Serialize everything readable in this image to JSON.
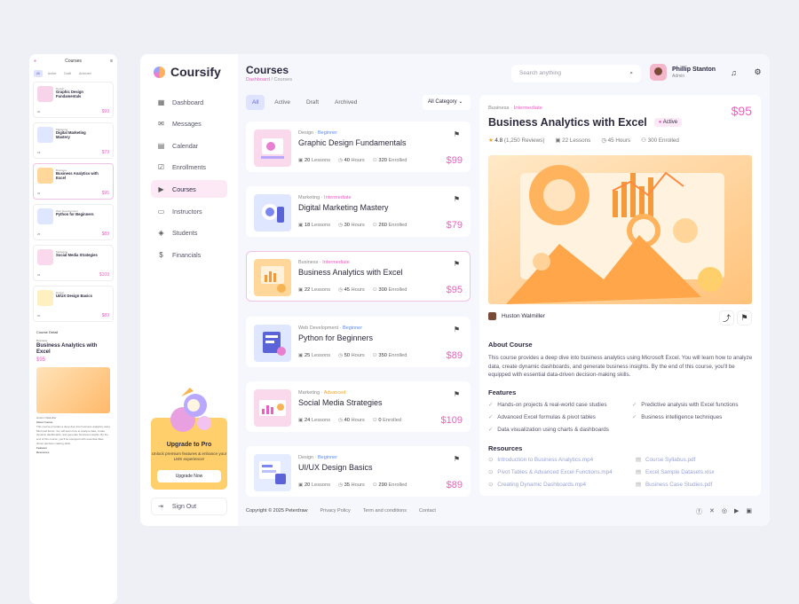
{
  "app": {
    "name": "Coursify"
  },
  "colors": {
    "accent": "#ec5ec2",
    "primary": "#5b64d6",
    "upgrade": "#ffcf6b"
  },
  "page": {
    "title": "Courses",
    "breadcrumb": [
      "Dashboard",
      "Courses"
    ]
  },
  "search": {
    "placeholder": "Search anything"
  },
  "user": {
    "name": "Phillip Stanton",
    "role": "Admin"
  },
  "nav": [
    {
      "label": "Dashboard",
      "icon": "grid-icon"
    },
    {
      "label": "Messages",
      "icon": "mail-icon"
    },
    {
      "label": "Calendar",
      "icon": "calendar-icon"
    },
    {
      "label": "Enrollments",
      "icon": "checkbox-icon"
    },
    {
      "label": "Courses",
      "icon": "play-icon"
    },
    {
      "label": "Instructors",
      "icon": "board-icon"
    },
    {
      "label": "Students",
      "icon": "graduation-icon"
    },
    {
      "label": "Financials",
      "icon": "dollar-icon"
    }
  ],
  "upgrade": {
    "title": "Upgrade to Pro",
    "subtitle": "Unlock premium features & enhance your LMS experience!",
    "button": "Upgrade Now"
  },
  "signout": {
    "label": "Sign Out"
  },
  "tabs": [
    "All",
    "Active",
    "Draft",
    "Archived"
  ],
  "category_filter": "All Category",
  "courses": [
    {
      "category": "Design",
      "level": "Beginner",
      "title": "Graphic Design Fundamentals",
      "lessons": "20",
      "hours": "40",
      "enrolled": "320",
      "price": "$99"
    },
    {
      "category": "Marketing",
      "level": "Intermediate",
      "title": "Digital Marketing Mastery",
      "lessons": "18",
      "hours": "30",
      "enrolled": "260",
      "price": "$79"
    },
    {
      "category": "Business",
      "level": "Intermediate",
      "title": "Business Analytics with Excel",
      "lessons": "22",
      "hours": "45",
      "enrolled": "300",
      "price": "$95"
    },
    {
      "category": "Web Development",
      "level": "Beginner",
      "title": "Python for Beginners",
      "lessons": "25",
      "hours": "50",
      "enrolled": "350",
      "price": "$89"
    },
    {
      "category": "Marketing",
      "level": "Advanced",
      "title": "Social Media Strategies",
      "lessons": "24",
      "hours": "40",
      "enrolled": "0",
      "price": "$109"
    },
    {
      "category": "Design",
      "level": "Beginner",
      "title": "UI/UX Design Basics",
      "lessons": "20",
      "hours": "35",
      "enrolled": "290",
      "price": "$89"
    }
  ],
  "labels": {
    "lessons": "Lessons",
    "hours": "Hours",
    "enrolled": "Enrolled"
  },
  "detail": {
    "category": "Business",
    "level": "Intermediate",
    "price": "$95",
    "title": "Business Analytics with Excel",
    "status": "Active",
    "rating": "4.8",
    "reviews": "(1,250 Reviews)",
    "lessons": "22 Lessons",
    "hours": "45 Hours",
    "enrolled": "300 Enrolled",
    "instructor": "Huston Walmiller",
    "about_title": "About Course",
    "about": "This course provides a deep dive into business analytics using Microsoft Excel. You will learn how to analyze data, create dynamic dashboards, and generate business insights. By the end of this course, you'll be equipped with essential data-driven decision-making skills.",
    "features_title": "Features",
    "features": [
      "Hands-on projects & real-world case studies",
      "Predictive analysis with Excel functions",
      "Advanced Excel formulas & pivot tables",
      "Business intelligence techniques",
      "Data visualization using charts & dashboards"
    ],
    "resources_title": "Resources",
    "videos": [
      "Introduction to Business Analytics.mp4",
      "Pivot Tables & Advanced Excel Functions.mp4",
      "Creating Dynamic Dashboards.mp4"
    ],
    "docs": [
      "Course Syllabus.pdf",
      "Excel Sample Datasets.xlsx",
      "Business Case Studies.pdf"
    ]
  },
  "footer": {
    "copyright": "Copyright © 2025 Peterdraw",
    "links": [
      "Privacy Policy",
      "Term and conditions",
      "Contact"
    ]
  },
  "mobile": {
    "title": "Courses",
    "detail_header": "Course Detail"
  }
}
